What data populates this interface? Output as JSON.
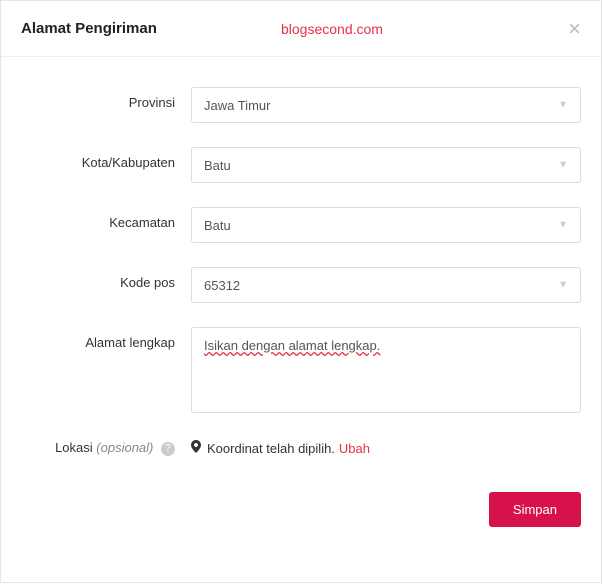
{
  "header": {
    "title": "Alamat Pengiriman",
    "blog": "blogsecond.com",
    "close": "×"
  },
  "form": {
    "province": {
      "label": "Provinsi",
      "value": "Jawa Timur"
    },
    "city": {
      "label": "Kota/Kabupaten",
      "value": "Batu"
    },
    "district": {
      "label": "Kecamatan",
      "value": "Batu"
    },
    "postal": {
      "label": "Kode pos",
      "value": "65312"
    },
    "address": {
      "label": "Alamat lengkap",
      "value": "Isikan dengan alamat lengkap."
    },
    "location": {
      "label_main": "Lokasi ",
      "label_opt": "(opsional)",
      "pin": "📍",
      "status": "Koordinat telah dipilih.",
      "change": "Ubah",
      "help": "?"
    }
  },
  "footer": {
    "save": "Simpan"
  }
}
